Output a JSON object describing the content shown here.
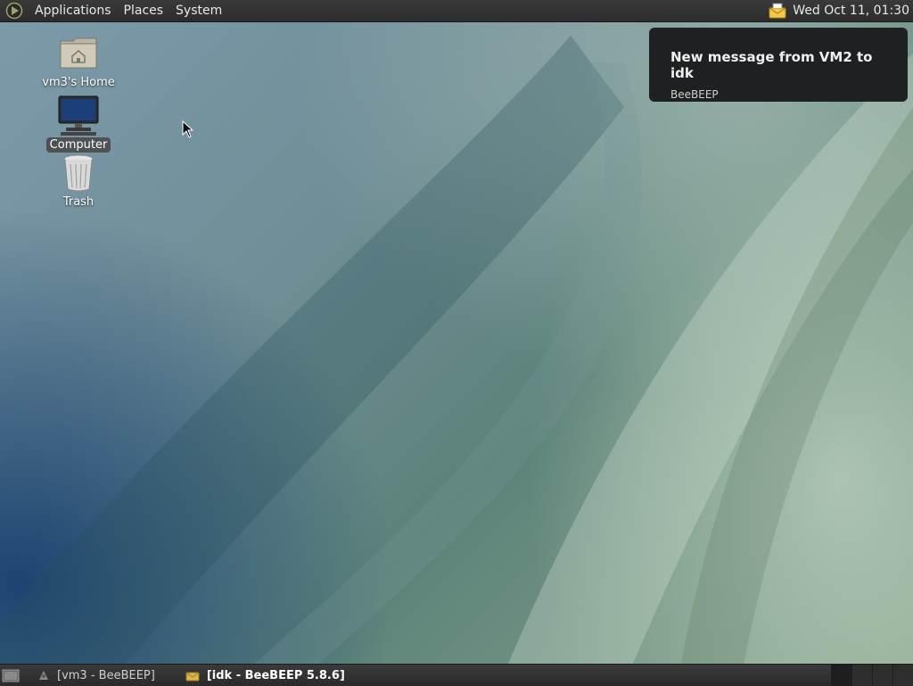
{
  "top_panel": {
    "menus": [
      "Applications",
      "Places",
      "System"
    ],
    "tray_icon": "beebeep-mail-icon",
    "clock": "Wed Oct 11, 01:30"
  },
  "desktop": {
    "icons": [
      {
        "label": "vm3's Home",
        "icon": "home-folder-icon",
        "selected": false
      },
      {
        "label": "Computer",
        "icon": "computer-icon",
        "selected": true
      },
      {
        "label": "Trash",
        "icon": "trash-icon",
        "selected": false
      }
    ]
  },
  "notification": {
    "title": "New message from VM2 to idk",
    "app": "BeeBEEP"
  },
  "bottom_panel": {
    "tasks": [
      {
        "label": "[vm3 - BeeBEEP]",
        "icon": "beebeep-icon",
        "active": false
      },
      {
        "label": "[idk - BeeBEEP 5.8.6]",
        "icon": "beebeep-mail-icon",
        "active": true
      }
    ],
    "workspaces": 4
  },
  "colors": {
    "panel": "#2c2c2c",
    "notification_bg": "#1f2021"
  }
}
